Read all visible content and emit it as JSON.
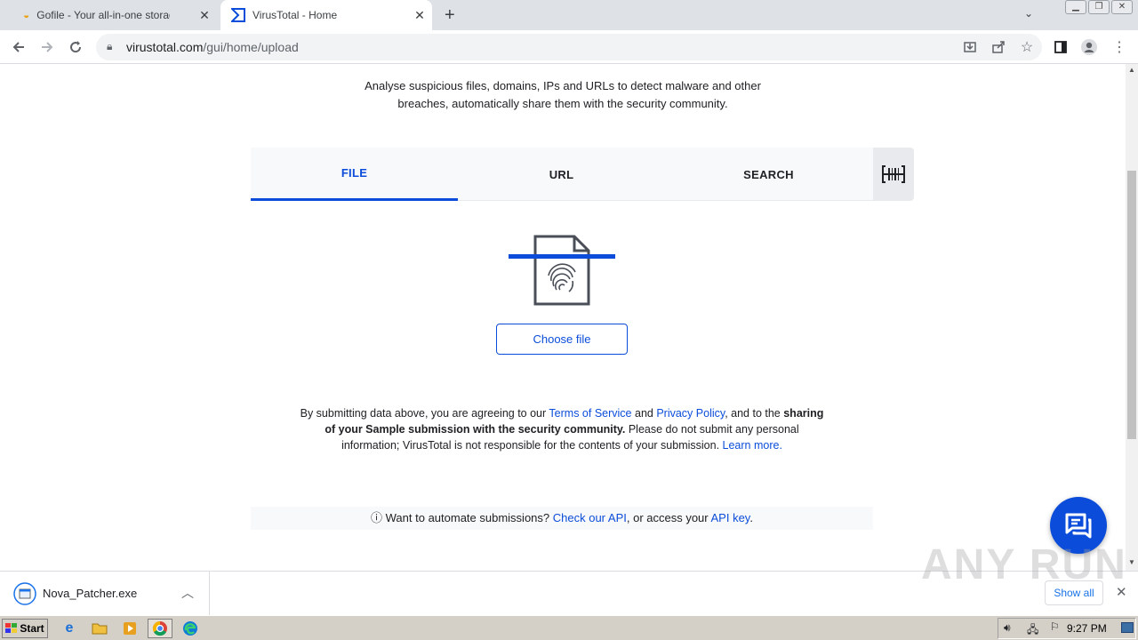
{
  "browser": {
    "tabs": [
      {
        "title": "Gofile - Your all-in-one storage soluti",
        "active": false
      },
      {
        "title": "VirusTotal - Home",
        "active": true
      }
    ],
    "url_host": "virustotal.com",
    "url_path": "/gui/home/upload"
  },
  "page": {
    "intro_line1": "Analyse suspicious files, domains, IPs and URLs to detect malware and other",
    "intro_line2": "breaches, automatically share them with the security community.",
    "tabs": [
      "FILE",
      "URL",
      "SEARCH"
    ],
    "choose_file": "Choose file",
    "terms": {
      "p1": "By submitting data above, you are agreeing to our ",
      "tos": "Terms of Service",
      "and": " and ",
      "privacy": "Privacy Policy",
      "p2": ", and to the ",
      "bold1": "sharing",
      "bold2": "of your Sample submission with the security community.",
      "p3": " Please do not submit any personal",
      "p4": "information; VirusTotal is not responsible for the contents of your submission. ",
      "learn": "Learn more."
    },
    "api": {
      "info_glyph": "ⓘ",
      "t1": " Want to automate submissions? ",
      "link1": "Check our API",
      "t2": ", or access your ",
      "link2": "API key",
      "t3": "."
    }
  },
  "downloads": {
    "file": "Nova_Patcher.exe",
    "show_all": "Show all"
  },
  "watermark": "ANY RUN",
  "taskbar": {
    "start": "Start",
    "clock": "9:27 PM"
  },
  "colors": {
    "accent": "#0b4dda",
    "tabstrip": "#dee1e6"
  }
}
